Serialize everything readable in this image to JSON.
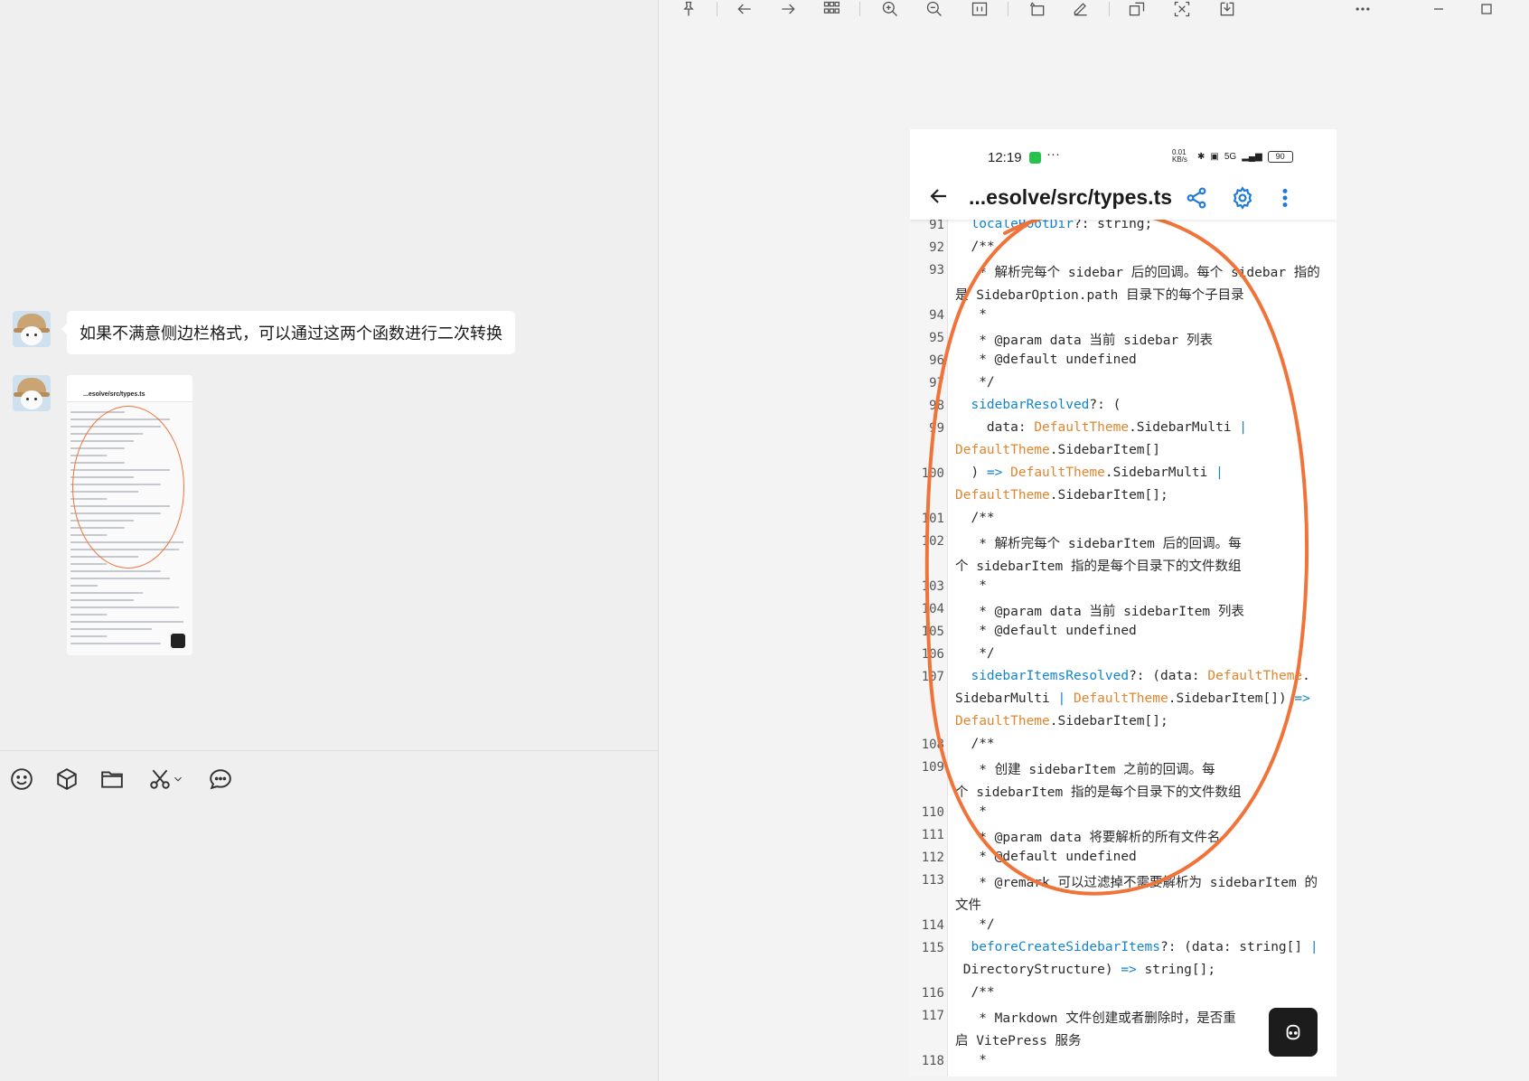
{
  "chat": {
    "message_text": "如果不满意侧边栏格式，可以通过这两个函数进行二次转换",
    "thumbnail_title": "...esolve/src/types.ts"
  },
  "toolbar_icons": [
    "emoji-icon",
    "box-icon",
    "folder-icon",
    "scissors-icon",
    "chevron-down-icon",
    "chat-bubble-icon"
  ],
  "viewer_toolbar_icons": [
    "pin-icon",
    "arrow-left-icon",
    "arrow-right-icon",
    "grid-icon",
    "zoom-in-icon",
    "zoom-out-icon",
    "actual-size-icon",
    "rotate-icon",
    "edit-icon",
    "ocr-icon",
    "translate-icon",
    "download-icon",
    "more-icon",
    "minimize-icon",
    "maximize-icon"
  ],
  "phone": {
    "status_time": "12:19",
    "status_dots": "···",
    "status_speed": "0.01 KB/s",
    "status_network": "5G",
    "battery": "90",
    "title": "...esolve/src/types.ts",
    "line_numbers": [
      "91",
      "92",
      "93",
      "94",
      "95",
      "96",
      "97",
      "98",
      "99",
      "100",
      "101",
      "102",
      "103",
      "104",
      "105",
      "106",
      "107",
      "108",
      "109",
      "110",
      "111",
      "112",
      "113",
      "114",
      "115",
      "116",
      "117",
      "118"
    ],
    "code": {
      "l91": [
        "  ",
        "localeRootDir",
        "?: string;"
      ],
      "l92": "  /**",
      "l93a": "   * 解析完每个 sidebar 后的回调。每个 sidebar 指的",
      "l93b": "是 SidebarOption.path 目录下的每个子目录",
      "l94": "   *",
      "l95": "   * @param data 当前 sidebar 列表",
      "l96": "   * @default undefined",
      "l97": "   */",
      "l98": [
        "  ",
        "sidebarResolved",
        "?: ("
      ],
      "l99a": [
        "    data: ",
        "DefaultTheme",
        ".SidebarMulti ",
        "|"
      ],
      "l99b": [
        "DefaultTheme",
        ".SidebarItem[]"
      ],
      "l100a": [
        "  ) ",
        "=>",
        " ",
        "DefaultTheme",
        ".SidebarMulti ",
        "|"
      ],
      "l100b": [
        "DefaultTheme",
        ".SidebarItem[];"
      ],
      "l101": "  /**",
      "l102a": "   * 解析完每个 sidebarItem 后的回调。每",
      "l102b": "个 sidebarItem 指的是每个目录下的文件数组",
      "l103": "   *",
      "l104": "   * @param data 当前 sidebarItem 列表",
      "l105": "   * @default undefined",
      "l106": "   */",
      "l107a": [
        "  ",
        "sidebarItemsResolved",
        "?: (data: ",
        "DefaultTheme",
        "."
      ],
      "l107b": [
        "SidebarMulti ",
        "|",
        " ",
        "DefaultTheme",
        ".SidebarItem[]) ",
        "=>"
      ],
      "l107c": [
        "DefaultTheme",
        ".SidebarItem[];"
      ],
      "l108": "  /**",
      "l109a": "   * 创建 sidebarItem 之前的回调。每",
      "l109b": "个 sidebarItem 指的是每个目录下的文件数组",
      "l110": "   *",
      "l111": "   * @param data 将要解析的所有文件名",
      "l112": "   * @default undefined",
      "l113a": "   * @remark 可以过滤掉不需要解析为 sidebarItem 的",
      "l113b": "文件",
      "l114": "   */",
      "l115a": [
        "  ",
        "beforeCreateSidebarItems",
        "?: (data: string[] ",
        "|"
      ],
      "l115b": [
        " DirectoryStructure) ",
        "=>",
        " string[];"
      ],
      "l116": "  /**",
      "l117a": "   * Markdown 文件创建或者删除时，是否重",
      "l117b": "启 VitePress 服务",
      "l118": "   *"
    }
  },
  "colors": {
    "accent": "#1e7ad6",
    "annotation": "#f0733a",
    "type": "#e0862f",
    "identifier": "#1584c9"
  }
}
